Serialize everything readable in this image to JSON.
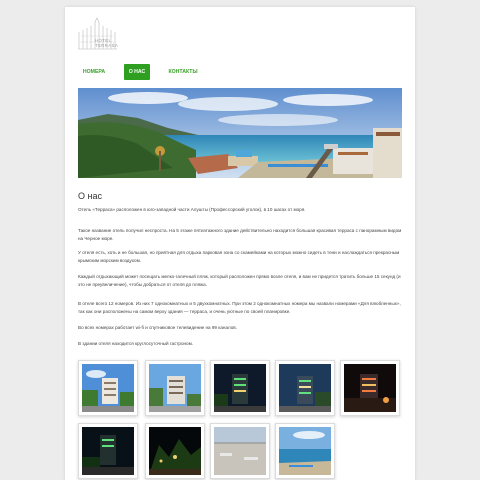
{
  "logo": {
    "line1": "HOTEL",
    "line2": "TERRASA"
  },
  "nav": {
    "items": [
      {
        "label": "НОМЕРА"
      },
      {
        "label": "О НАС",
        "active": true
      },
      {
        "label": "КОНТАКТЫ"
      }
    ]
  },
  "colors": {
    "accent": "#2f9f21",
    "background": "#ececec",
    "page": "#ffffff"
  },
  "main": {
    "title": "О нас",
    "paragraphs": [
      "Отель «Терраса» расположен в юго-западной части Алушты (Профессорский уголок), в 10 шагах от моря.",
      "Такое название отель получил неспроста. На 5 этаже пятиэтажного здание действительно находится большая красивая терраса с панорамным видом на Черное море.",
      "У отеля есть, хоть и не большая, но приятная для отдыха парковая зона со скамейками на которых можно сидеть в тени и наслаждаться прекрасным крымским морским воздухом.",
      "Каждый отдыхающий может посещать мелко-галечный пляж, который расположен прямо возле отеля, и вам не придется тратить больше 15 секунд (и это не преувеличение), чтобы добраться от отеля до пляжа.",
      "В отеле всего 12 номеров. Из них 7 однокомнатных и 5 двухкомнатных. При этом 2 однокомнатных номера мы назвали номерами «Для влюбленных», так как они расположены на самом верху здания — терраса, и очень уютные по своей планировке.",
      "Во всех номерах работает wi-fi и спутниковое телевидение на 99 каналов.",
      "В здании отеля находится круглосуточный гастроном."
    ]
  },
  "gallery": {
    "photos": [
      {
        "icon": "hotel-day-photo",
        "scene": "day"
      },
      {
        "icon": "hotel-day-photo",
        "scene": "day"
      },
      {
        "icon": "hotel-night-photo",
        "scene": "night"
      },
      {
        "icon": "hotel-night-photo",
        "scene": "dusk"
      },
      {
        "icon": "hotel-night-photo",
        "scene": "night"
      },
      {
        "icon": "hotel-night-photo",
        "scene": "night"
      },
      {
        "icon": "park-night-photo",
        "scene": "park"
      },
      {
        "icon": "terrace-photo",
        "scene": "terrace"
      },
      {
        "icon": "sea-view-photo",
        "scene": "sea"
      }
    ]
  }
}
